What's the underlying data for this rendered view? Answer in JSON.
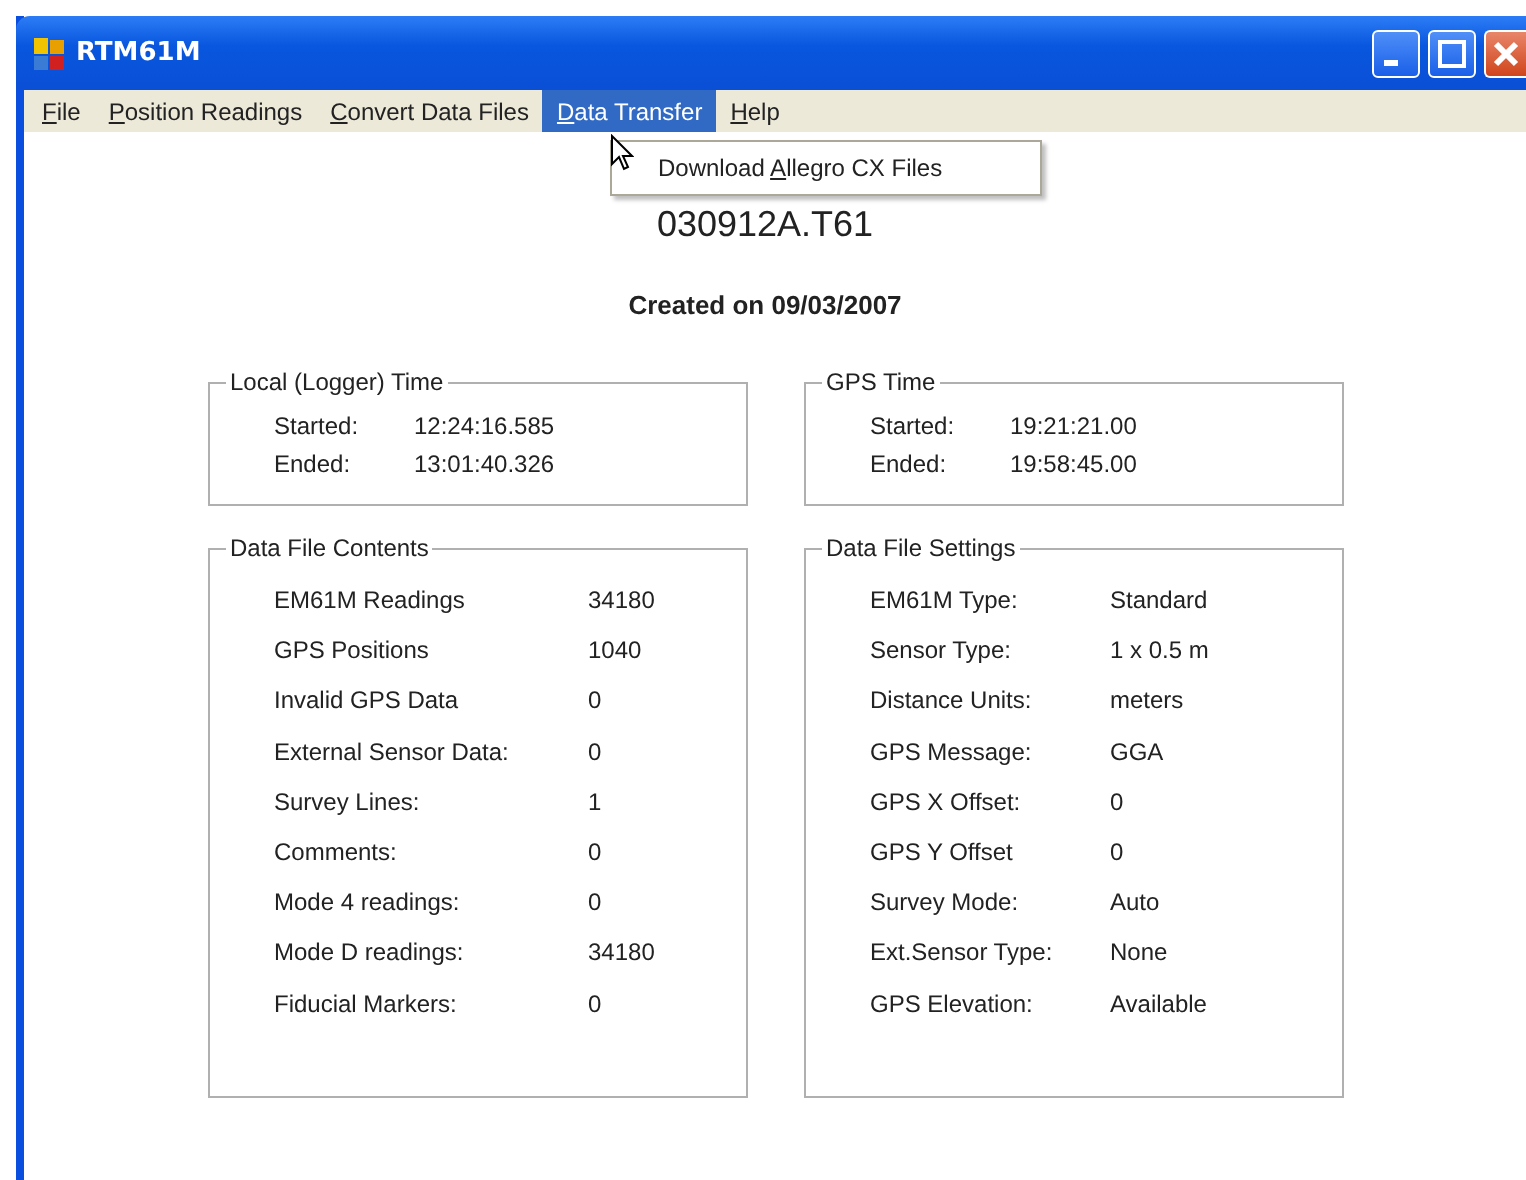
{
  "window": {
    "title": "RTM61M"
  },
  "menu": [
    {
      "key": "F",
      "rest": "ile",
      "selected": false
    },
    {
      "key": "P",
      "rest": "osition Readings",
      "selected": false
    },
    {
      "key": "C",
      "rest": "onvert Data Files",
      "selected": false
    },
    {
      "key": "D",
      "rest": "ata Transfer",
      "selected": true
    },
    {
      "key": "H",
      "rest": "elp",
      "selected": false
    }
  ],
  "dropdown": {
    "items": [
      {
        "pre": "Download ",
        "key": "A",
        "rest": "llegro CX Files"
      }
    ]
  },
  "file_name": "030912A.T61",
  "created": "Created on 09/03/2007",
  "groups": [
    {
      "title": "Local (Logger) Time",
      "kind": "time",
      "rows": [
        {
          "label": "Started:",
          "value": "12:24:16.585"
        },
        {
          "label": "Ended:",
          "value": "13:01:40.326"
        }
      ]
    },
    {
      "title": "GPS Time",
      "kind": "time",
      "rows": [
        {
          "label": "Started:",
          "value": "19:21:21.00"
        },
        {
          "label": "Ended:",
          "value": "19:58:45.00"
        }
      ]
    },
    {
      "title": "Data File Contents",
      "kind": "contents",
      "rows": [
        {
          "label": "EM61M Readings",
          "value": "34180"
        },
        {
          "label": "GPS Positions",
          "value": "1040"
        },
        {
          "label": "Invalid GPS Data",
          "value": "0"
        },
        {
          "label": "External Sensor Data:",
          "value": "0"
        },
        {
          "label": "Survey Lines:",
          "value": "1"
        },
        {
          "label": "Comments:",
          "value": "0"
        },
        {
          "label": "Mode 4 readings:",
          "value": "0"
        },
        {
          "label": "Mode D readings:",
          "value": "34180"
        },
        {
          "label": "Fiducial Markers:",
          "value": "0"
        }
      ]
    },
    {
      "title": "Data File Settings",
      "kind": "settings",
      "rows": [
        {
          "label": "EM61M Type:",
          "value": "Standard"
        },
        {
          "label": "Sensor Type:",
          "value": "1 x 0.5 m"
        },
        {
          "label": "Distance Units:",
          "value": "meters"
        },
        {
          "label": "GPS Message:",
          "value": "GGA"
        },
        {
          "label": "GPS X Offset:",
          "value": "0"
        },
        {
          "label": "GPS Y Offset",
          "value": "0"
        },
        {
          "label": "Survey Mode:",
          "value": "Auto"
        },
        {
          "label": "Ext.Sensor Type:",
          "value": "None"
        },
        {
          "label": "GPS Elevation:",
          "value": "Available"
        }
      ]
    }
  ]
}
